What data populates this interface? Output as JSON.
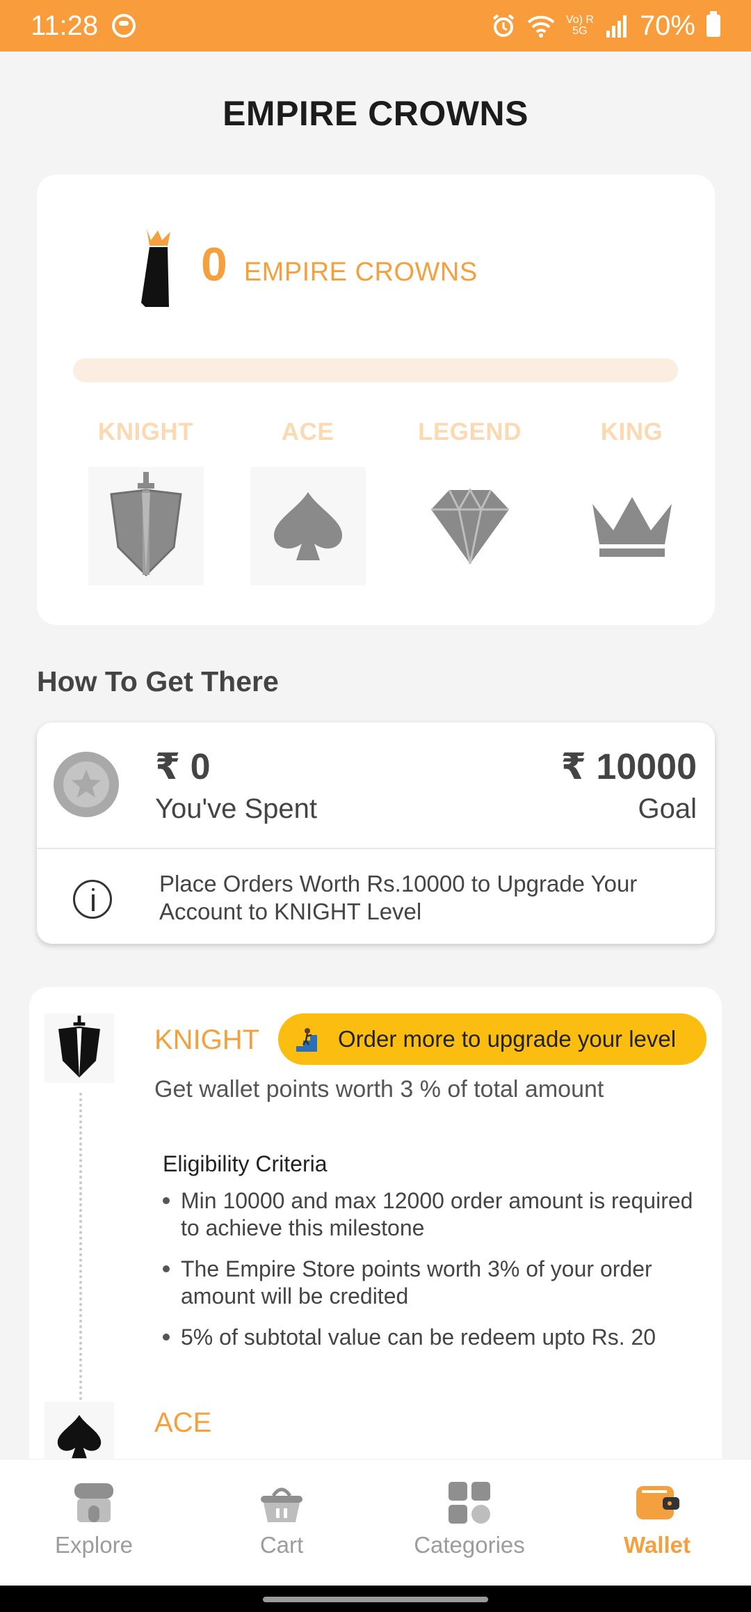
{
  "status_bar": {
    "time": "11:28",
    "signal_text": "Vo) R",
    "network_text": "5G",
    "battery": "70%"
  },
  "page": {
    "title": "EMPIRE CROWNS"
  },
  "crowns": {
    "count": "0",
    "label": "EMPIRE CROWNS",
    "progress": 0,
    "levels": [
      {
        "name": "KNIGHT",
        "icon": "knight-shield-icon"
      },
      {
        "name": "ACE",
        "icon": "spade-icon"
      },
      {
        "name": "LEGEND",
        "icon": "diamond-icon"
      },
      {
        "name": "KING",
        "icon": "crown-icon"
      }
    ]
  },
  "how_to": {
    "section_title": "How To Get There",
    "spent_amount": "₹ 0",
    "spent_label": "You've Spent",
    "goal_amount": "₹ 10000",
    "goal_label": "Goal",
    "info_text": "Place Orders Worth Rs.10000 to Upgrade Your Account to KNIGHT Level"
  },
  "knight": {
    "name": "KNIGHT",
    "badge_text": "Order more to upgrade your level",
    "description": "Get wallet points worth 3 % of total amount",
    "eligibility_title": "Eligibility Criteria",
    "criteria": [
      "Min 10000  and max 12000 order amount is required to achieve this milestone",
      "The Empire Store points worth 3% of your order amount will be credited",
      "5% of subtotal value can be redeem upto Rs. 20"
    ]
  },
  "ace": {
    "name": "ACE"
  },
  "bottom_nav": {
    "items": [
      {
        "label": "Explore",
        "icon": "store-icon",
        "active": false
      },
      {
        "label": "Cart",
        "icon": "basket-icon",
        "active": false
      },
      {
        "label": "Categories",
        "icon": "grid-icon",
        "active": false
      },
      {
        "label": "Wallet",
        "icon": "wallet-icon",
        "active": true
      }
    ]
  },
  "colors": {
    "status_bar": "#f99d3c",
    "accent": "#f5a03f",
    "badge": "#fbbd10",
    "inactive": "#9c9c9c"
  }
}
